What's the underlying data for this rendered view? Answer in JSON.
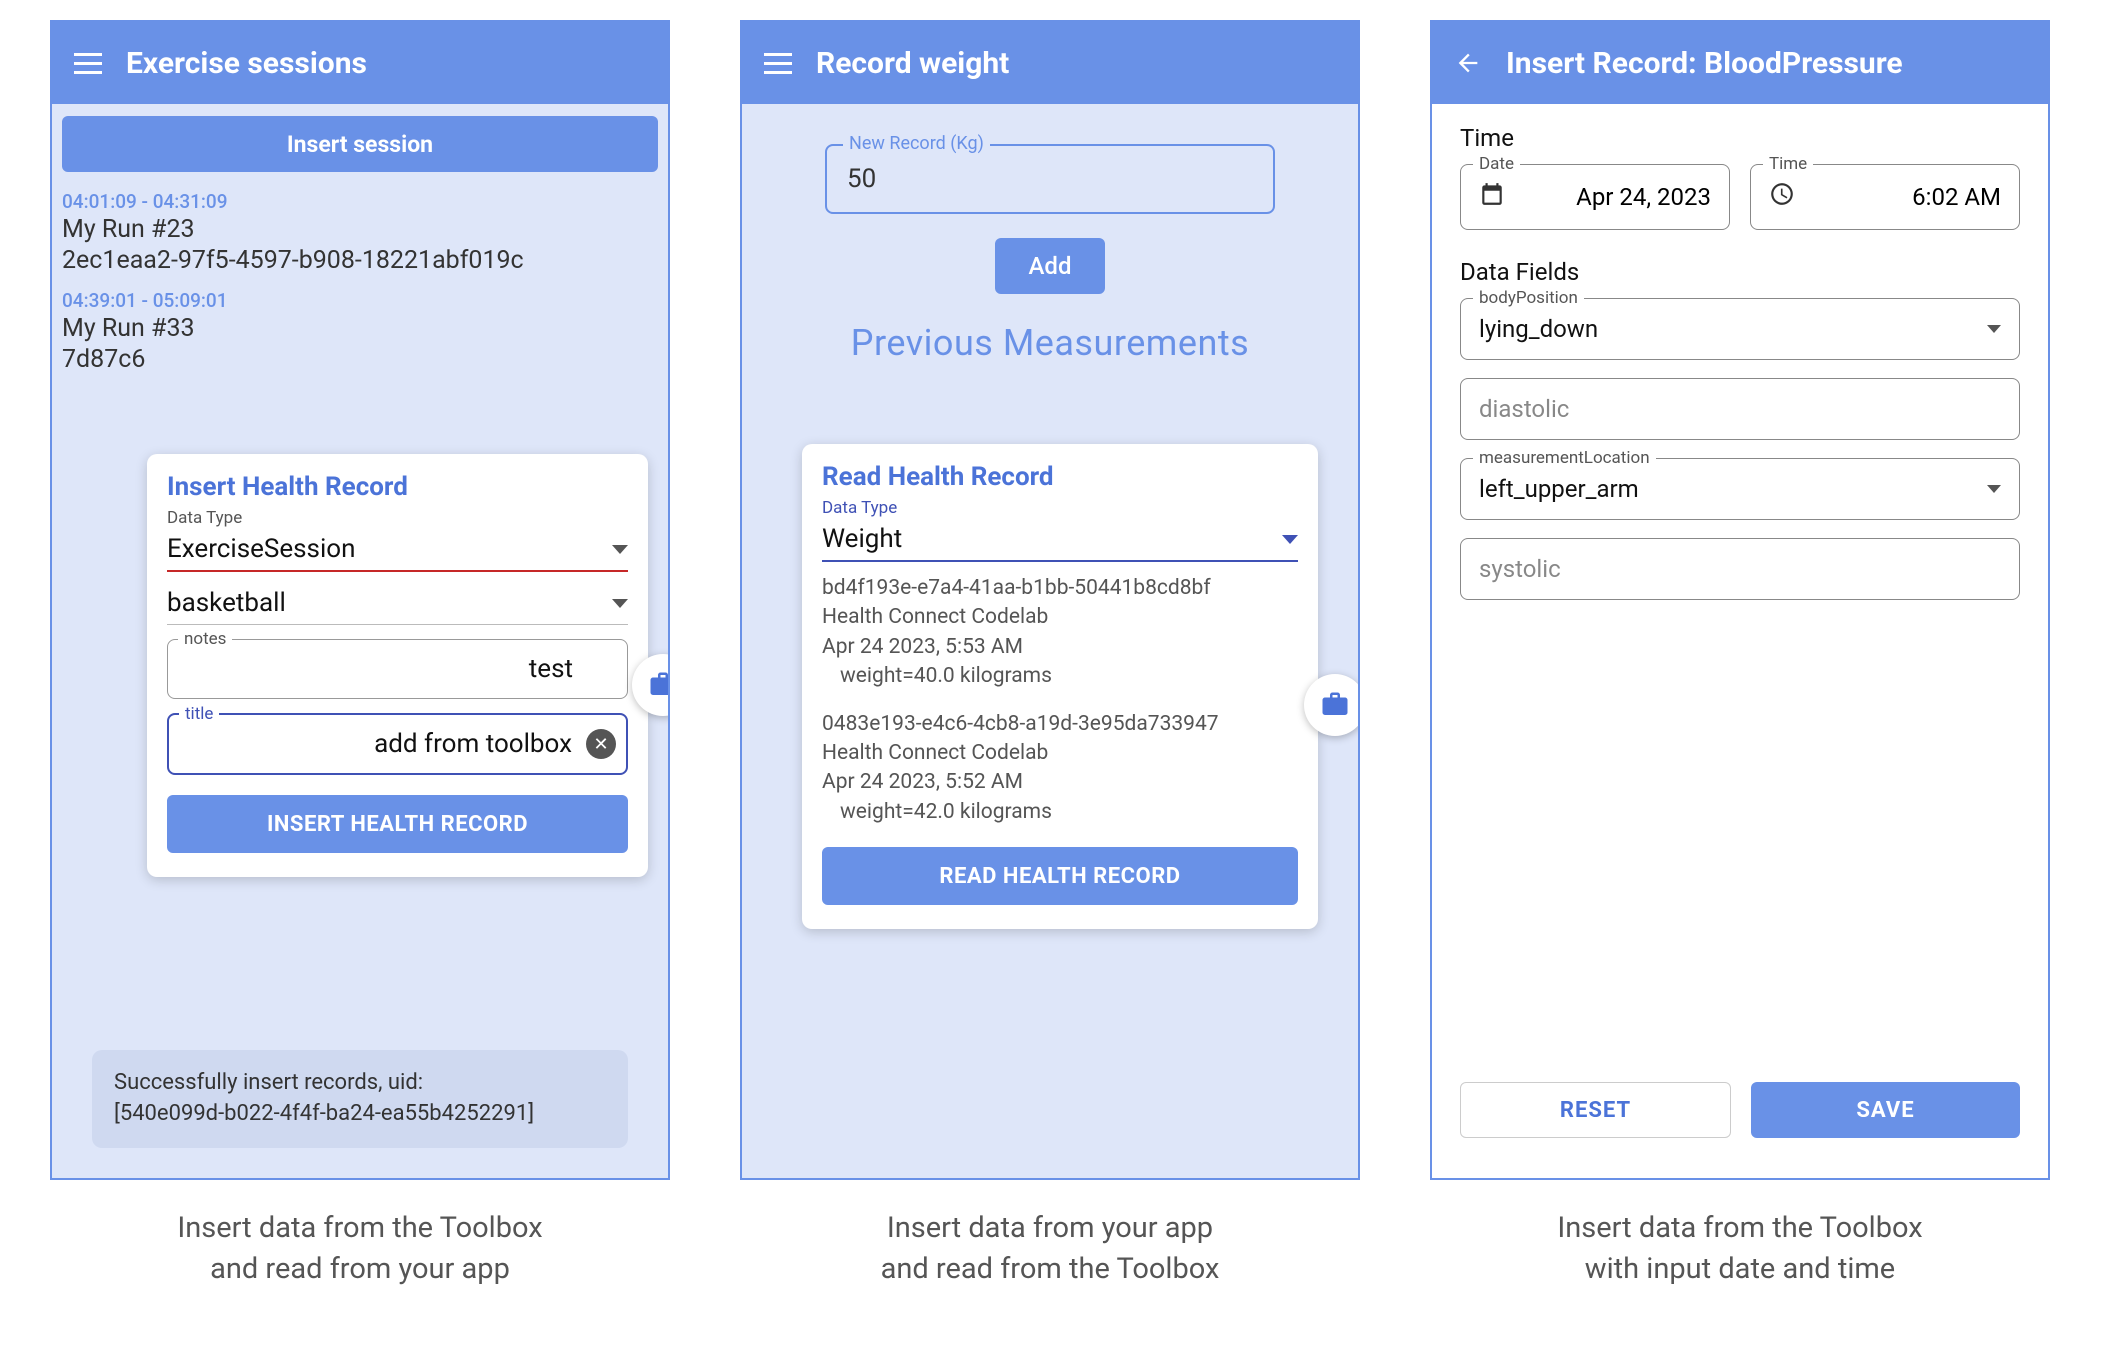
{
  "captions": {
    "one": "Insert data from the Toolbox\nand read from your app",
    "two": "Insert data from your app\nand read from the Toolbox",
    "three": "Insert data from the Toolbox\nwith input date and time"
  },
  "screen1": {
    "title": "Exercise sessions",
    "insertSessionBtn": "Insert session",
    "sessions": [
      {
        "time": "04:01:09 - 04:31:09",
        "title": "My Run #23",
        "uid": "2ec1eaa2-97f5-4597-b908-18221abf019c"
      },
      {
        "time": "04:39:01 - 05:09:01",
        "title": "My Run #33",
        "uid": "7d87c6"
      }
    ],
    "card": {
      "title": "Insert Health Record",
      "dataTypeLabel": "Data Type",
      "dataTypeValue": "ExerciseSession",
      "exerciseTypeValue": "basketball",
      "notesLabel": "notes",
      "notesValue": "test",
      "titleLabel": "title",
      "titleValue": "add from toolbox",
      "button": "INSERT HEALTH RECORD"
    },
    "snackbar": {
      "line1": "Successfully insert records, uid:",
      "line2": "[540e099d-b022-4f4f-ba24-ea55b4252291]"
    }
  },
  "screen2": {
    "title": "Record weight",
    "newRecordLabel": "New Record (Kg)",
    "newRecordValue": "50",
    "addBtn": "Add",
    "prevTitle": "Previous Measurements",
    "card": {
      "title": "Read Health Record",
      "dataTypeLabel": "Data Type",
      "dataTypeValue": "Weight",
      "records": [
        {
          "id": "bd4f193e-e7a4-41aa-b1bb-50441b8cd8bf",
          "app": "Health Connect Codelab",
          "ts": "Apr 24 2023, 5:53 AM",
          "val": "weight=40.0 kilograms"
        },
        {
          "id": "0483e193-e4c6-4cb8-a19d-3e95da733947",
          "app": "Health Connect Codelab",
          "ts": "Apr 24 2023, 5:52 AM",
          "val": "weight=42.0 kilograms"
        }
      ],
      "button": "READ HEALTH RECORD"
    }
  },
  "screen3": {
    "title": "Insert Record: BloodPressure",
    "timeSection": "Time",
    "dateLabel": "Date",
    "dateValue": "Apr 24, 2023",
    "timeLabel": "Time",
    "timeValue": "6:02 AM",
    "dataFieldsSection": "Data Fields",
    "bodyPositionLabel": "bodyPosition",
    "bodyPositionValue": "lying_down",
    "diastolicLabel": "diastolic",
    "measurementLocationLabel": "measurementLocation",
    "measurementLocationValue": "left_upper_arm",
    "systolicLabel": "systolic",
    "resetBtn": "RESET",
    "saveBtn": "SAVE"
  }
}
